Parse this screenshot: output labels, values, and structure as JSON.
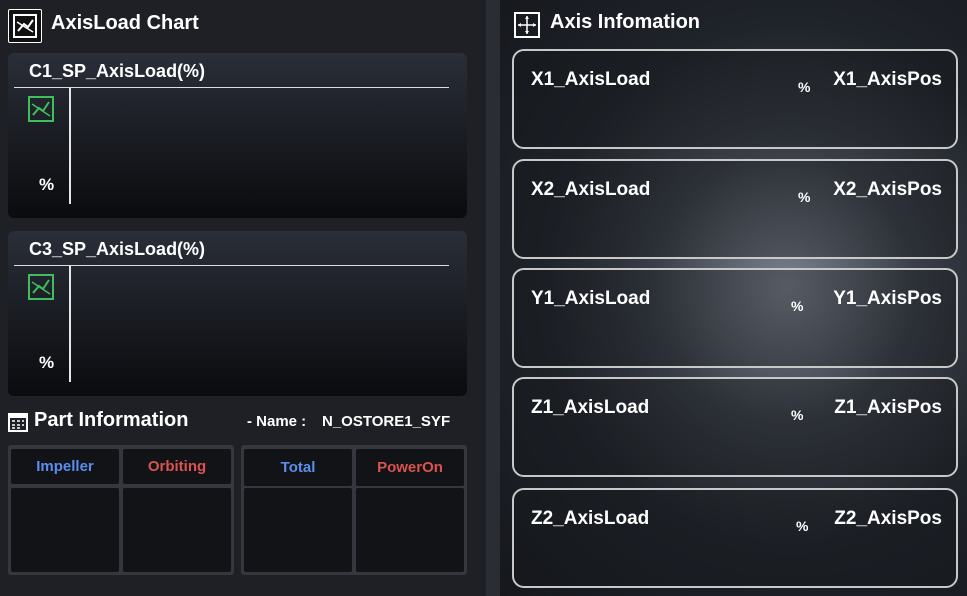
{
  "left_title": "AxisLoad Chart",
  "right_title": "Axis Infomation",
  "charts": [
    {
      "title": "C1_SP_AxisLoad(%)",
      "unit": "%"
    },
    {
      "title": "C3_SP_AxisLoad(%)",
      "unit": "%"
    }
  ],
  "part": {
    "title": "Part Information",
    "name_label": "- Name :",
    "name_value": "N_OSTORE1_SYF",
    "cols": [
      {
        "label": "Impeller",
        "color": "#5b8def"
      },
      {
        "label": "Orbiting",
        "color": "#d9534f"
      },
      {
        "label": "Total",
        "color": "#5b8def"
      },
      {
        "label": "PowerOn",
        "color": "#d9534f"
      }
    ]
  },
  "axes": [
    {
      "load": "X1_AxisLoad",
      "unit": "%",
      "pos": "X1_AxisPos"
    },
    {
      "load": "X2_AxisLoad",
      "unit": "%",
      "pos": "X2_AxisPos"
    },
    {
      "load": "Y1_AxisLoad",
      "unit": "%",
      "pos": "Y1_AxisPos"
    },
    {
      "load": "Z1_AxisLoad",
      "unit": "%",
      "pos": "Z1_AxisPos"
    },
    {
      "load": "Z2_AxisLoad",
      "unit": "%",
      "pos": "Z2_AxisPos"
    }
  ],
  "icons": {
    "chart": "chart-icon",
    "axis": "axis-icon",
    "part": "calendar-icon",
    "line_chart": "line-chart-icon"
  }
}
